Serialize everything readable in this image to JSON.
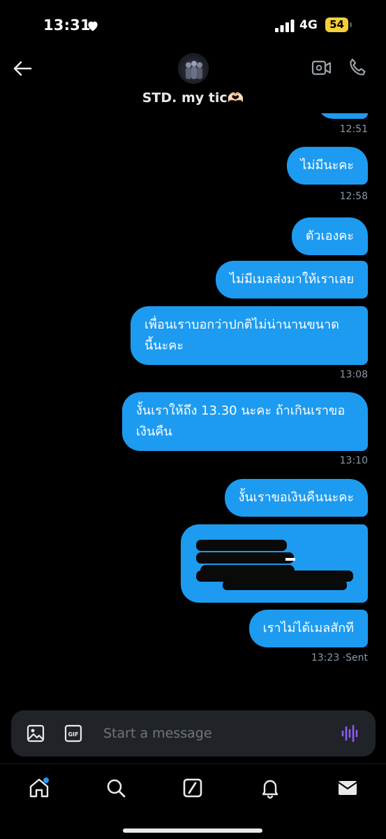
{
  "status_bar": {
    "time": "13:31",
    "network": "4G",
    "battery": "54"
  },
  "header": {
    "title": "STD. my tic🫶🏻"
  },
  "messages": [
    {
      "text": "ไม่มีนะคะ",
      "time": "12:58"
    },
    {
      "text": "ตัวเองคะ"
    },
    {
      "text": "ไม่มีเมลส่งมาให้เราเลย"
    },
    {
      "text": "เพื่อนเราบอกว่าปกติไม่น่านานขนาดนี้นะคะ",
      "line1": "เพื่อนเราบอกว่าปกติไม่น่านานขนาด",
      "line2": "นี้นะคะ",
      "time": "13:08"
    },
    {
      "text": "งั้นเราให้ถึง 13.30 นะคะ ถ้าเกินเราขอเงินคืน",
      "line1": "งั้นเราให้ถึง 13.30 นะคะ ถ้าเกินเราขอ",
      "line2": "เงินคืน",
      "time": "13:10"
    },
    {
      "text": "งั้นเราขอเงินคืนนะคะ"
    },
    {
      "text": "เราไม่ได้เมลสักที",
      "time": "13:23 ·Sent"
    }
  ],
  "earlier_time": "12:51",
  "composer": {
    "placeholder": "Start a message"
  },
  "colors": {
    "bubble": "#1d9bf0",
    "background": "#000000",
    "composer": "#202327",
    "voice_accent": "#8b5cf6",
    "notification_dot": "#1d9bf0",
    "battery": "#f5cf3a"
  },
  "icons": {
    "back": "arrow-left-icon",
    "video": "video-camera-icon",
    "call": "phone-icon",
    "image": "image-icon",
    "gif": "gif-icon",
    "voice": "voice-wave-icon",
    "tabs": [
      "home-icon",
      "search-icon",
      "grok-icon",
      "bell-icon",
      "mail-icon"
    ]
  }
}
